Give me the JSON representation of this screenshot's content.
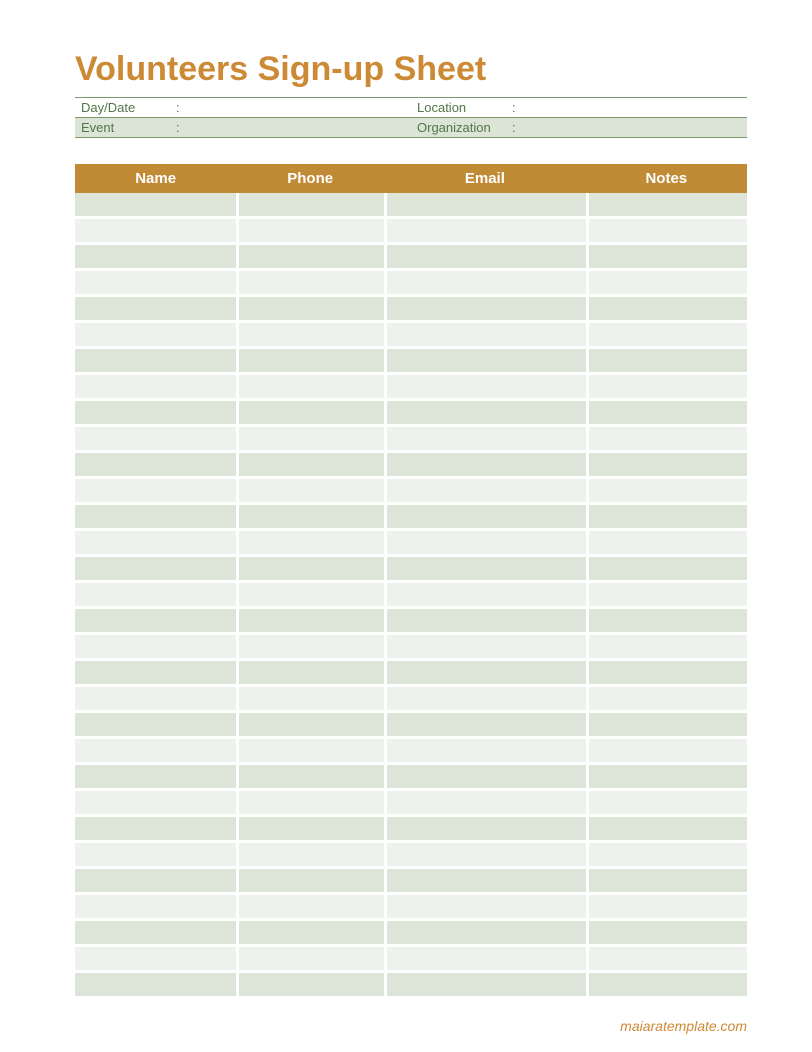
{
  "title": "Volunteers Sign-up Sheet",
  "info": {
    "dayDate": {
      "label": "Day/Date",
      "value": ""
    },
    "location": {
      "label": "Location",
      "value": ""
    },
    "event": {
      "label": "Event",
      "value": ""
    },
    "organization": {
      "label": "Organization",
      "value": ""
    }
  },
  "table": {
    "headers": {
      "name": "Name",
      "phone": "Phone",
      "email": "Email",
      "notes": "Notes"
    },
    "rowCount": 31
  },
  "footer": "maiaratemplate.com",
  "colors": {
    "title": "#cc8a35",
    "headerBg": "#c18a35",
    "infoBorder": "#7a9a6c",
    "infoText": "#527648",
    "rowEven": "#dde5d8",
    "rowOdd": "#eef2ec"
  }
}
